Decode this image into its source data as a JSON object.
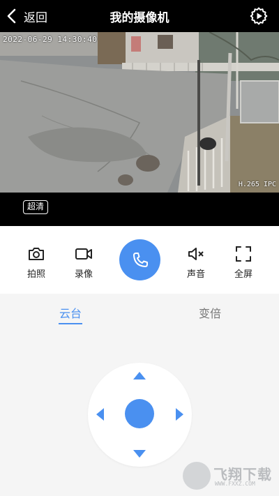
{
  "header": {
    "back_label": "返回",
    "title": "我的摄像机"
  },
  "video": {
    "timestamp": "2022-06-29 14:30:40",
    "codec": "H.265 IPC"
  },
  "quality": {
    "label": "超清"
  },
  "controls": {
    "snapshot_label": "拍照",
    "record_label": "录像",
    "sound_label": "声音",
    "fullscreen_label": "全屏"
  },
  "tabs": {
    "ptz_label": "云台",
    "zoom_label": "变倍",
    "active": "云台"
  },
  "watermark": {
    "text": "飞翔下载",
    "url": "WWW.FXXZ.COM"
  },
  "colors": {
    "accent": "#4a90f0",
    "header_bg": "#000000"
  }
}
